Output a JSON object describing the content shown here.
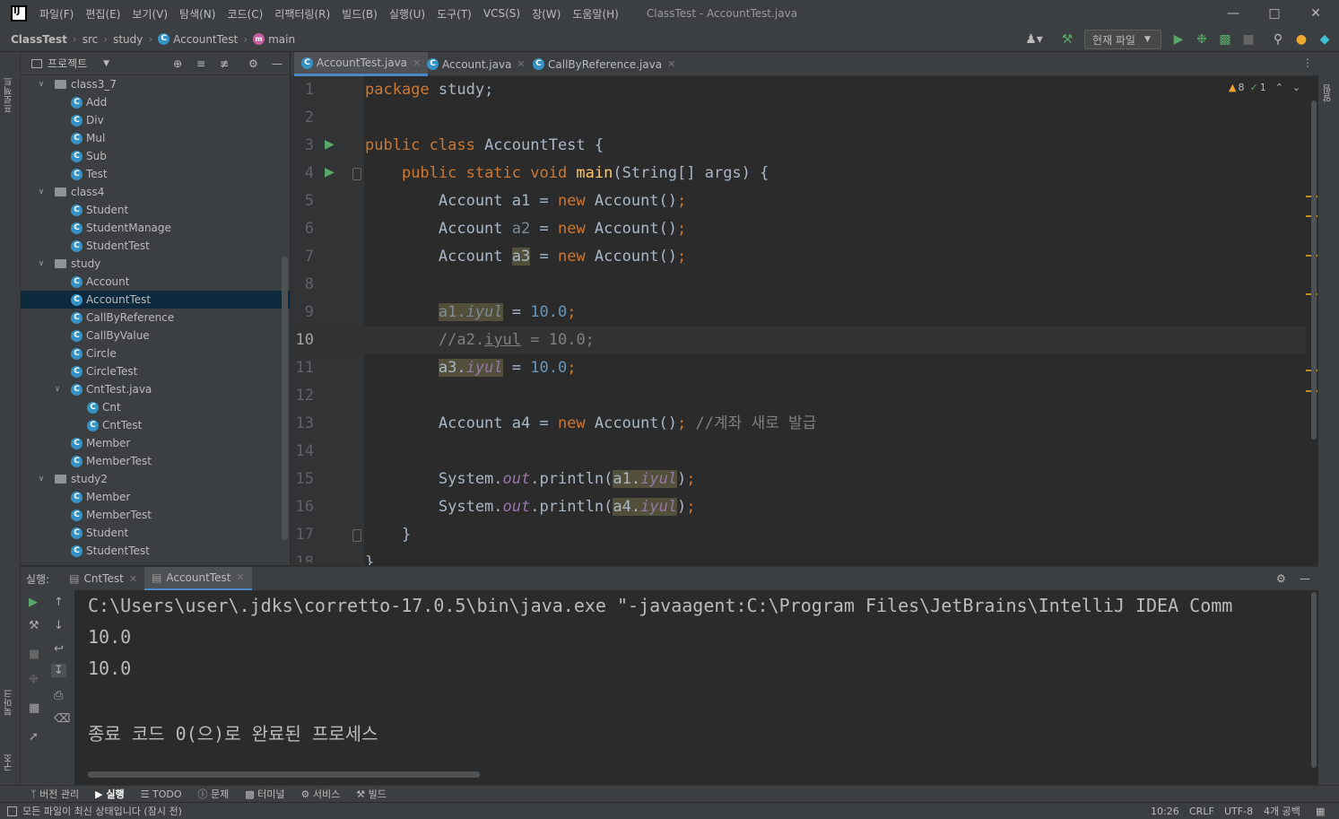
{
  "app": {
    "title": "ClassTest - AccountTest.java"
  },
  "menu": [
    "파일(F)",
    "편집(E)",
    "보기(V)",
    "탐색(N)",
    "코드(C)",
    "리팩터링(R)",
    "빌드(B)",
    "실행(U)",
    "도구(T)",
    "VCS(S)",
    "창(W)",
    "도움말(H)"
  ],
  "breadcrumb": [
    "ClassTest",
    "src",
    "study",
    "AccountTest",
    "main"
  ],
  "toolbar": {
    "run_config": "현재 파일"
  },
  "project": {
    "title": "프로젝트",
    "tree": [
      {
        "label": "class3_7",
        "type": "folder",
        "depth": 0,
        "expanded": true
      },
      {
        "label": "Add",
        "type": "class",
        "depth": 1
      },
      {
        "label": "Div",
        "type": "class",
        "depth": 1
      },
      {
        "label": "Mul",
        "type": "class",
        "depth": 1
      },
      {
        "label": "Sub",
        "type": "class",
        "depth": 1
      },
      {
        "label": "Test",
        "type": "class",
        "depth": 1
      },
      {
        "label": "class4",
        "type": "folder",
        "depth": 0,
        "expanded": true
      },
      {
        "label": "Student",
        "type": "class",
        "depth": 1
      },
      {
        "label": "StudentManage",
        "type": "class",
        "depth": 1
      },
      {
        "label": "StudentTest",
        "type": "class",
        "depth": 1
      },
      {
        "label": "study",
        "type": "folder",
        "depth": 0,
        "expanded": true
      },
      {
        "label": "Account",
        "type": "class",
        "depth": 1
      },
      {
        "label": "AccountTest",
        "type": "class",
        "depth": 1,
        "selected": true
      },
      {
        "label": "CallByReference",
        "type": "class",
        "depth": 1
      },
      {
        "label": "CallByValue",
        "type": "class",
        "depth": 1
      },
      {
        "label": "Circle",
        "type": "class",
        "depth": 1
      },
      {
        "label": "CircleTest",
        "type": "class",
        "depth": 1
      },
      {
        "label": "CntTest.java",
        "type": "file",
        "depth": 1,
        "expanded": true
      },
      {
        "label": "Cnt",
        "type": "class",
        "depth": 2
      },
      {
        "label": "CntTest",
        "type": "class",
        "depth": 2
      },
      {
        "label": "Member",
        "type": "class",
        "depth": 1
      },
      {
        "label": "MemberTest",
        "type": "class",
        "depth": 1
      },
      {
        "label": "study2",
        "type": "folder",
        "depth": 0,
        "expanded": true
      },
      {
        "label": "Member",
        "type": "class",
        "depth": 1
      },
      {
        "label": "MemberTest",
        "type": "class",
        "depth": 1
      },
      {
        "label": "Student",
        "type": "class",
        "depth": 1
      },
      {
        "label": "StudentTest",
        "type": "class",
        "depth": 1
      }
    ]
  },
  "editor": {
    "tabs": [
      {
        "label": "AccountTest.java",
        "active": true
      },
      {
        "label": "Account.java",
        "active": false
      },
      {
        "label": "CallByReference.java",
        "active": false
      }
    ],
    "warnings": "8",
    "weak_warnings": "1",
    "current_line": "10",
    "lines": [
      "1",
      "2",
      "3",
      "4",
      "5",
      "6",
      "7",
      "8",
      "9",
      "10",
      "11",
      "12",
      "13",
      "14",
      "15",
      "16",
      "17",
      "18"
    ]
  },
  "run": {
    "label": "실행:",
    "tabs": [
      "CntTest",
      "AccountTest"
    ],
    "output": [
      "C:\\Users\\user\\.jdks\\corretto-17.0.5\\bin\\java.exe \"-javaagent:C:\\Program Files\\JetBrains\\IntelliJ IDEA Comm",
      "10.0",
      "10.0",
      "",
      "종료 코드 0(으)로 완료된 프로세스"
    ]
  },
  "bottom_tabs": [
    "버전 관리",
    "실행",
    "TODO",
    "문제",
    "터미널",
    "서비스",
    "빌드"
  ],
  "status": {
    "message": "모든 파일이 최신 상태입니다 (잠시 전)",
    "position": "10:26",
    "line_sep": "CRLF",
    "encoding": "UTF-8",
    "indent": "4개 공백"
  },
  "side_tabs": {
    "project": "프로젝트",
    "bookmarks": "북마크",
    "structure": "구조",
    "notifications": "알림"
  }
}
